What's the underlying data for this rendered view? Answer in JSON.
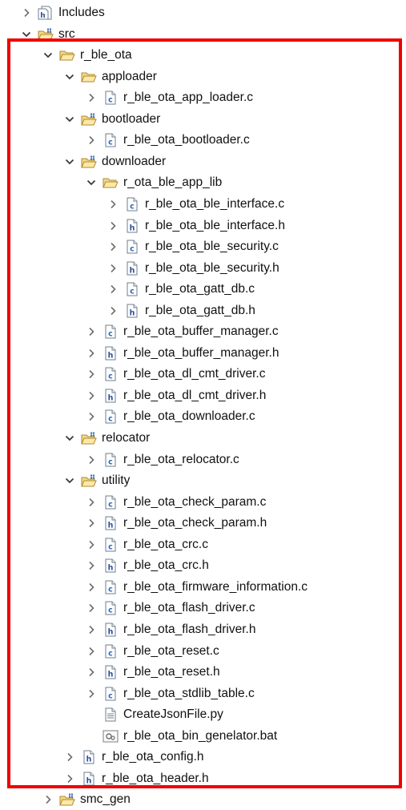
{
  "tree": [
    {
      "id": "includes",
      "label": "Includes",
      "icon": "includes-icon",
      "chev": "right",
      "depth": 0
    },
    {
      "id": "src",
      "label": "src",
      "icon": "source-folder-icon",
      "chev": "down",
      "depth": 0
    },
    {
      "id": "r-ble-ota",
      "label": "r_ble_ota",
      "icon": "folder-open-icon",
      "chev": "down",
      "depth": 1
    },
    {
      "id": "apploader",
      "label": "apploader",
      "icon": "folder-open-icon",
      "chev": "down",
      "depth": 2
    },
    {
      "id": "r-ble-ota-app-loader-c",
      "label": "r_ble_ota_app_loader.c",
      "icon": "c-file-icon",
      "chev": "right",
      "depth": 3
    },
    {
      "id": "bootloader",
      "label": "bootloader",
      "icon": "source-folder-icon",
      "chev": "down",
      "depth": 2
    },
    {
      "id": "r-ble-ota-bootloader-c",
      "label": "r_ble_ota_bootloader.c",
      "icon": "c-file-icon",
      "chev": "right",
      "depth": 3
    },
    {
      "id": "downloader",
      "label": "downloader",
      "icon": "source-folder-icon",
      "chev": "down",
      "depth": 2
    },
    {
      "id": "r-ota-ble-app-lib",
      "label": "r_ota_ble_app_lib",
      "icon": "folder-open-icon",
      "chev": "down",
      "depth": 3
    },
    {
      "id": "r-ble-ota-ble-interface-c",
      "label": "r_ble_ota_ble_interface.c",
      "icon": "c-file-icon",
      "chev": "right",
      "depth": 4
    },
    {
      "id": "r-ble-ota-ble-interface-h",
      "label": "r_ble_ota_ble_interface.h",
      "icon": "h-file-icon",
      "chev": "right",
      "depth": 4
    },
    {
      "id": "r-ble-ota-ble-security-c",
      "label": "r_ble_ota_ble_security.c",
      "icon": "c-file-icon",
      "chev": "right",
      "depth": 4
    },
    {
      "id": "r-ble-ota-ble-security-h",
      "label": "r_ble_ota_ble_security.h",
      "icon": "h-file-icon",
      "chev": "right",
      "depth": 4
    },
    {
      "id": "r-ble-ota-gatt-db-c",
      "label": "r_ble_ota_gatt_db.c",
      "icon": "c-file-icon",
      "chev": "right",
      "depth": 4
    },
    {
      "id": "r-ble-ota-gatt-db-h",
      "label": "r_ble_ota_gatt_db.h",
      "icon": "h-file-icon",
      "chev": "right",
      "depth": 4
    },
    {
      "id": "r-ble-ota-buffer-manager-c",
      "label": "r_ble_ota_buffer_manager.c",
      "icon": "c-file-icon",
      "chev": "right",
      "depth": 3
    },
    {
      "id": "r-ble-ota-buffer-manager-h",
      "label": "r_ble_ota_buffer_manager.h",
      "icon": "h-file-icon",
      "chev": "right",
      "depth": 3
    },
    {
      "id": "r-ble-ota-dl-cmt-driver-c",
      "label": "r_ble_ota_dl_cmt_driver.c",
      "icon": "c-file-icon",
      "chev": "right",
      "depth": 3
    },
    {
      "id": "r-ble-ota-dl-cmt-driver-h",
      "label": "r_ble_ota_dl_cmt_driver.h",
      "icon": "h-file-icon",
      "chev": "right",
      "depth": 3
    },
    {
      "id": "r-ble-ota-downloader-c",
      "label": "r_ble_ota_downloader.c",
      "icon": "c-file-icon",
      "chev": "right",
      "depth": 3
    },
    {
      "id": "relocator",
      "label": "relocator",
      "icon": "source-folder-icon",
      "chev": "down",
      "depth": 2
    },
    {
      "id": "r-ble-ota-relocator-c",
      "label": "r_ble_ota_relocator.c",
      "icon": "c-file-icon",
      "chev": "right",
      "depth": 3
    },
    {
      "id": "utility",
      "label": "utility",
      "icon": "source-folder-icon",
      "chev": "down",
      "depth": 2
    },
    {
      "id": "r-ble-ota-check-param-c",
      "label": "r_ble_ota_check_param.c",
      "icon": "c-file-icon",
      "chev": "right",
      "depth": 3
    },
    {
      "id": "r-ble-ota-check-param-h",
      "label": "r_ble_ota_check_param.h",
      "icon": "h-file-icon",
      "chev": "right",
      "depth": 3
    },
    {
      "id": "r-ble-ota-crc-c",
      "label": "r_ble_ota_crc.c",
      "icon": "c-file-icon",
      "chev": "right",
      "depth": 3
    },
    {
      "id": "r-ble-ota-crc-h",
      "label": "r_ble_ota_crc.h",
      "icon": "h-file-icon",
      "chev": "right",
      "depth": 3
    },
    {
      "id": "r-ble-ota-firmware-information-c",
      "label": "r_ble_ota_firmware_information.c",
      "icon": "c-file-icon",
      "chev": "right",
      "depth": 3
    },
    {
      "id": "r-ble-ota-flash-driver-c",
      "label": "r_ble_ota_flash_driver.c",
      "icon": "c-file-icon",
      "chev": "right",
      "depth": 3
    },
    {
      "id": "r-ble-ota-flash-driver-h",
      "label": "r_ble_ota_flash_driver.h",
      "icon": "h-file-icon",
      "chev": "right",
      "depth": 3
    },
    {
      "id": "r-ble-ota-reset-c",
      "label": "r_ble_ota_reset.c",
      "icon": "c-file-icon",
      "chev": "right",
      "depth": 3
    },
    {
      "id": "r-ble-ota-reset-h",
      "label": "r_ble_ota_reset.h",
      "icon": "h-file-icon",
      "chev": "right",
      "depth": 3
    },
    {
      "id": "r-ble-ota-stdlib-table-c",
      "label": "r_ble_ota_stdlib_table.c",
      "icon": "c-file-icon",
      "chev": "right",
      "depth": 3
    },
    {
      "id": "createjsonfile-py",
      "label": "CreateJsonFile.py",
      "icon": "text-file-icon",
      "chev": "none",
      "depth": 3
    },
    {
      "id": "r-ble-ota-bin-genelator-bat",
      "label": "r_ble_ota_bin_genelator.bat",
      "icon": "batch-file-icon",
      "chev": "none",
      "depth": 3
    },
    {
      "id": "r-ble-ota-config-h",
      "label": "r_ble_ota_config.h",
      "icon": "h-file-icon",
      "chev": "right",
      "depth": 2
    },
    {
      "id": "r-ble-ota-header-h",
      "label": "r_ble_ota_header.h",
      "icon": "h-file-icon",
      "chev": "right",
      "depth": 2
    },
    {
      "id": "smc-gen",
      "label": "smc_gen",
      "icon": "source-folder-icon",
      "chev": "right",
      "depth": 1
    }
  ],
  "highlight_color": "#ee0000"
}
